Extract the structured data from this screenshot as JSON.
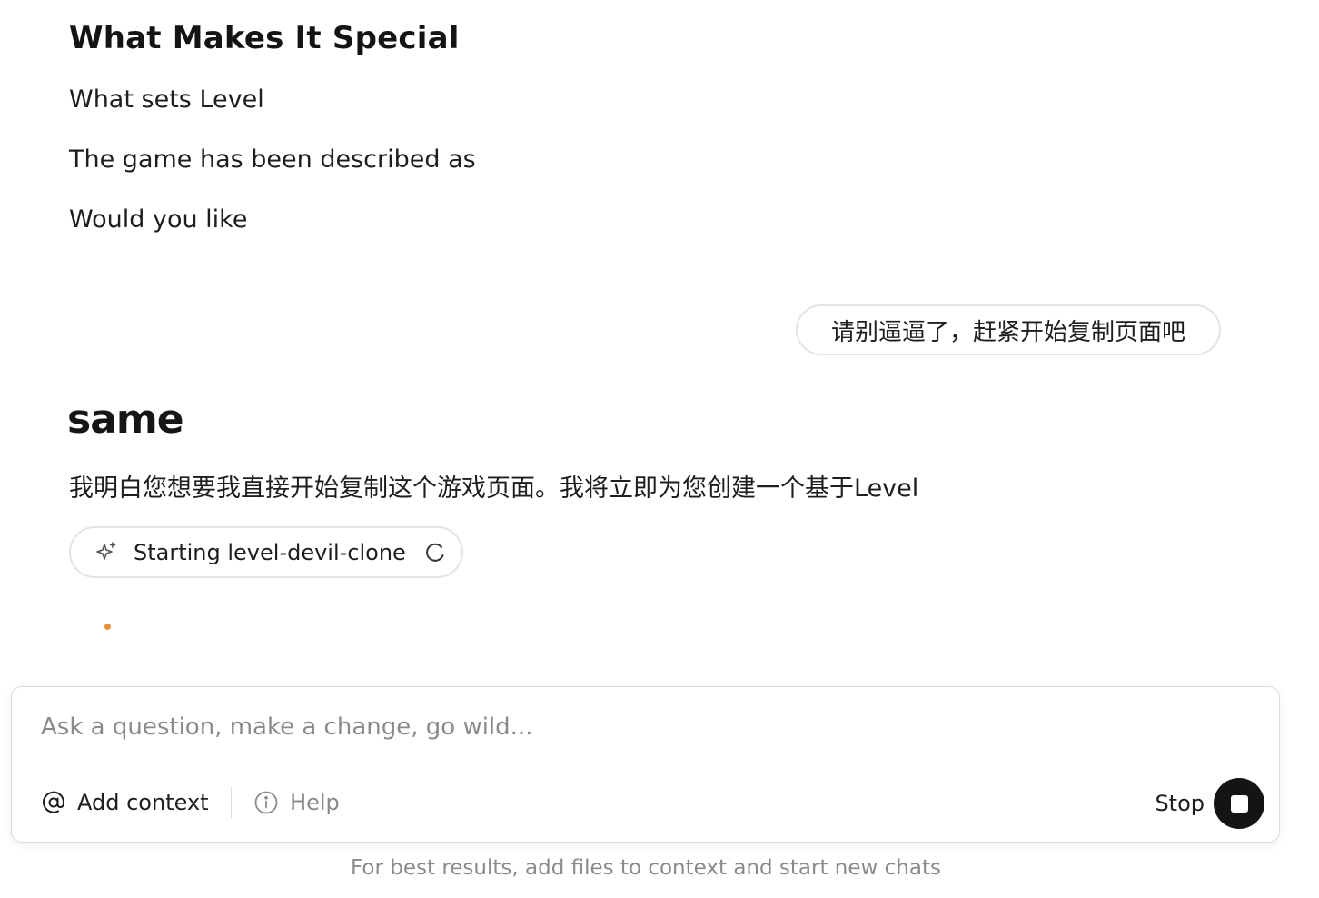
{
  "article": {
    "heading": "What Makes It Special",
    "paragraphs": [
      "What sets Level",
      "The game has been described as",
      "Would you like"
    ]
  },
  "user_message": {
    "text": "请别逼逼了，赶紧开始复制页面吧"
  },
  "assistant": {
    "brand": "same",
    "message": "我明白您想要我直接开始复制这个游戏页面。我将立即为您创建一个基于Level",
    "status": {
      "icon": "sparkle-icon",
      "text": "Starting level-devil-clone",
      "spinner_icon": "spinner-icon"
    },
    "typing_indicator_color": "#e8903a"
  },
  "composer": {
    "placeholder": "Ask a question, make a change, go wild...",
    "value": "",
    "add_context_label": "Add context",
    "add_context_icon": "at-sign-icon",
    "help_label": "Help",
    "help_icon": "info-icon",
    "stop_label": "Stop",
    "stop_icon": "stop-icon",
    "stop_button_color": "#141414"
  },
  "footer": {
    "hint": "For best results, add files to context and start new chats"
  }
}
